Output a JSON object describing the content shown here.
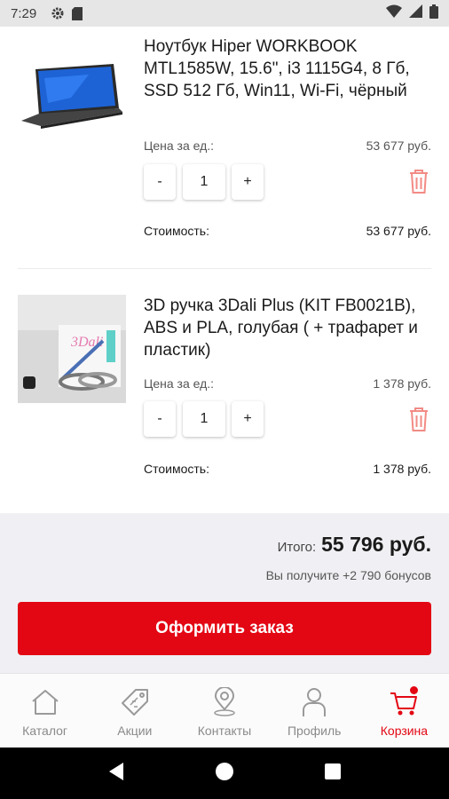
{
  "status_bar": {
    "time": "7:29"
  },
  "cart": {
    "items": [
      {
        "name": "Ноутбук Hiper WORKBOOK MTL1585W, 15.6\",  i3 1115G4,  8 Гб, SSD 512 Гб, Win11, Wi-Fi, чёрный",
        "unit_price_label": "Цена за ед.:",
        "unit_price": "53 677 руб.",
        "qty_minus": "-",
        "quantity": "1",
        "qty_plus": "+",
        "cost_label": "Стоимость:",
        "cost": "53 677 руб."
      },
      {
        "name": "3D ручка 3Dali Plus (KIT FB0021B), ABS и PLA, голубая ( + трафарет и пластик)",
        "unit_price_label": "Цена за ед.:",
        "unit_price": "1 378 руб.",
        "qty_minus": "-",
        "quantity": "1",
        "qty_plus": "+",
        "cost_label": "Стоимость:",
        "cost": "1 378 руб."
      }
    ],
    "total_label": "Итого:",
    "total": "55 796 руб.",
    "bonus": "Вы получите +2 790 бонусов",
    "checkout_label": "Оформить заказ"
  },
  "bottom_nav": [
    {
      "label": "Каталог",
      "icon": "home-icon"
    },
    {
      "label": "Акции",
      "icon": "tag-icon"
    },
    {
      "label": "Контакты",
      "icon": "map-pin-icon"
    },
    {
      "label": "Профиль",
      "icon": "user-icon"
    },
    {
      "label": "Корзина",
      "icon": "cart-icon",
      "active": true
    }
  ],
  "colors": {
    "accent": "#e30613",
    "summary_bg": "#f0f0f4",
    "nav_inactive": "#8a8a8a"
  }
}
